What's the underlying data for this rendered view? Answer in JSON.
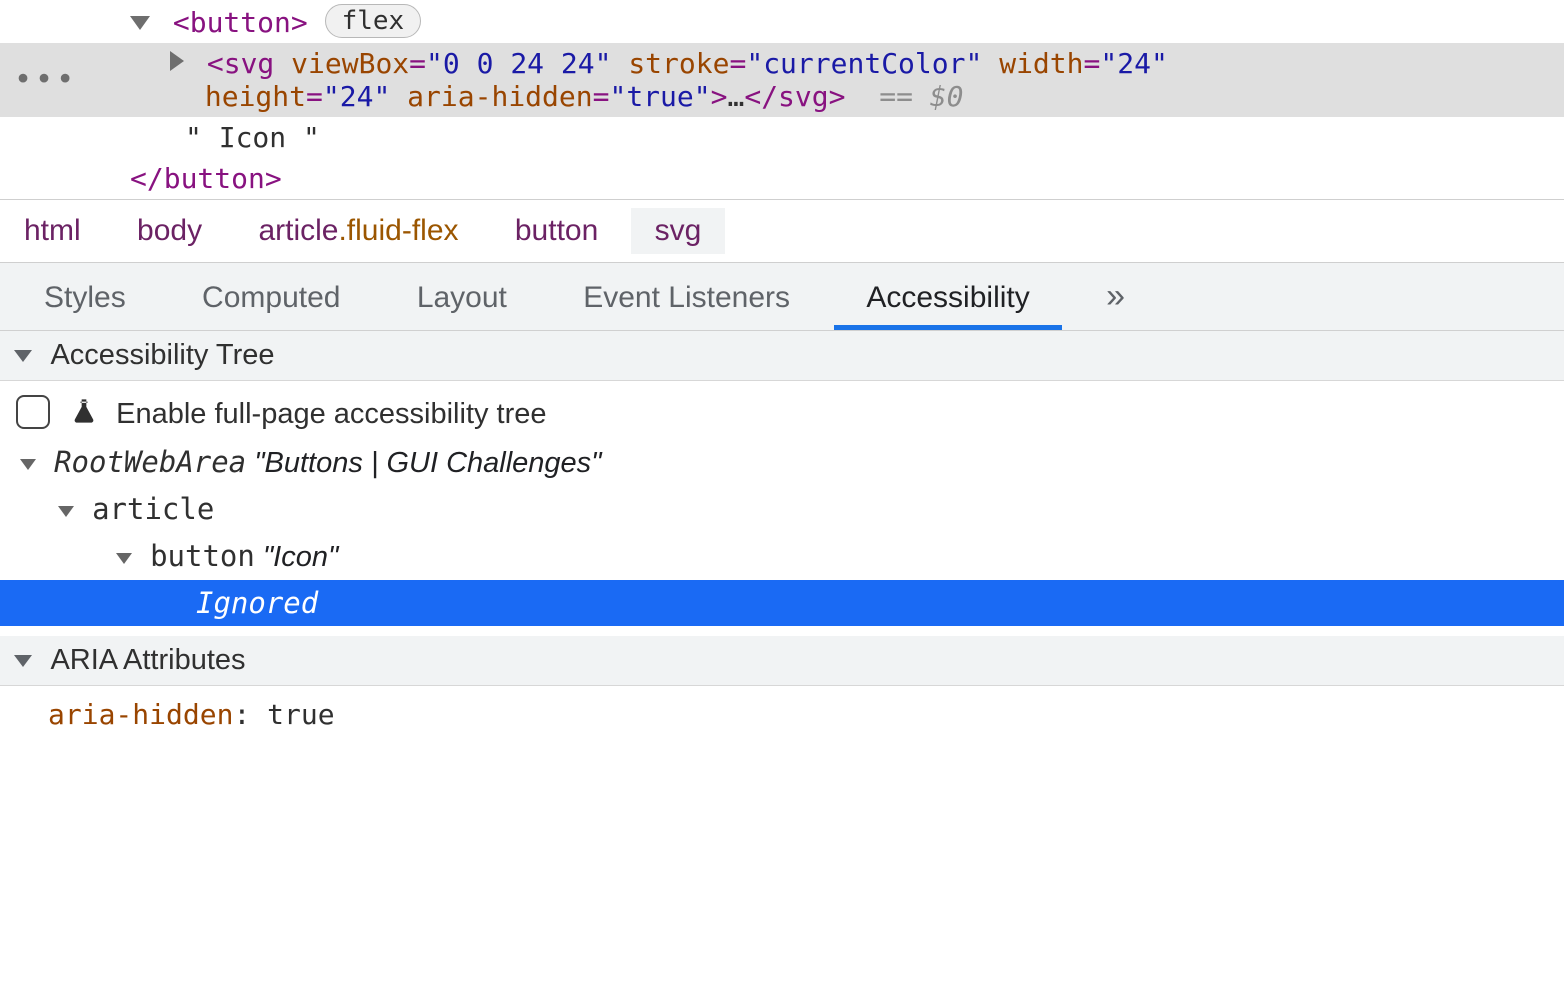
{
  "dom": {
    "button_open": "<button>",
    "button_close": "</button>",
    "flex_badge": "flex",
    "svg_parts": {
      "open": "<svg",
      "viewBox_attr": "viewBox",
      "viewBox_val": "\"0 0 24 24\"",
      "stroke_attr": "stroke",
      "stroke_val": "\"currentColor\"",
      "width_attr": "width",
      "width_val": "\"24\"",
      "height_attr": "height",
      "height_val": "\"24\"",
      "aria_attr": "aria-hidden",
      "aria_val": "\"true\"",
      "close_open": ">",
      "ellipsis": "…",
      "end_tag": "</svg>"
    },
    "eq0": "== $0",
    "text_node": "\" Icon \""
  },
  "breadcrumbs": [
    {
      "label": "html"
    },
    {
      "label": "body"
    },
    {
      "label": "article",
      "suffix": ".fluid-flex"
    },
    {
      "label": "button"
    },
    {
      "label": "svg",
      "selected": true
    }
  ],
  "tabs": {
    "items": [
      "Styles",
      "Computed",
      "Layout",
      "Event Listeners",
      "Accessibility"
    ],
    "active": "Accessibility",
    "more": "»"
  },
  "acc_section": {
    "title": "Accessibility Tree",
    "enable_label": "Enable full-page accessibility tree",
    "tree": {
      "root_role": "RootWebArea",
      "root_name": "\"Buttons | GUI Challenges\"",
      "article": "article",
      "button_role": "button",
      "button_name": "\"Icon\"",
      "ignored": "Ignored"
    }
  },
  "aria_section": {
    "title": "ARIA Attributes",
    "key": "aria-hidden",
    "value": "true"
  }
}
